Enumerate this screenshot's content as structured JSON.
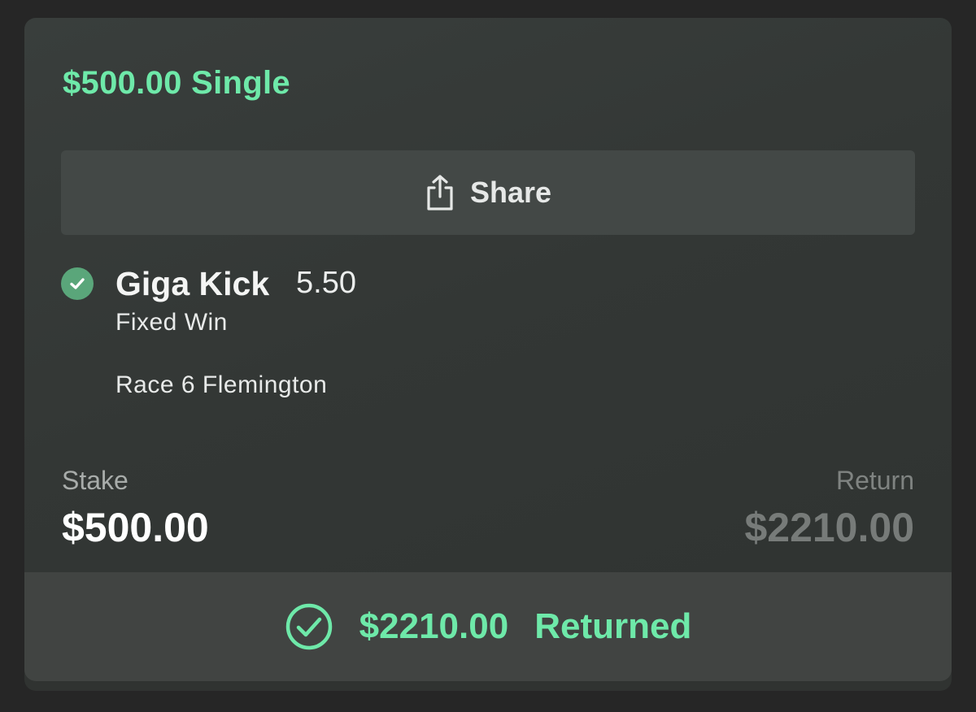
{
  "bet": {
    "title": "$500.00 Single"
  },
  "share_button": {
    "label": "Share",
    "icon": "share-icon"
  },
  "selection": {
    "status_icon": "check-circle-icon",
    "name": "Giga Kick",
    "odds": "5.50",
    "bet_type": "Fixed Win",
    "event": "Race 6 Flemington"
  },
  "stake": {
    "label": "Stake",
    "value": "$500.00"
  },
  "return": {
    "label": "Return",
    "value": "$2210.00"
  },
  "result": {
    "icon": "check-circle-outline-icon",
    "amount": "$2210.00",
    "status": "Returned"
  },
  "colors": {
    "accent_green": "#6ee9a9",
    "badge_green": "#5aa67a",
    "card_background": "#353937",
    "result_bar": "#414442",
    "page_background": "#262626"
  }
}
